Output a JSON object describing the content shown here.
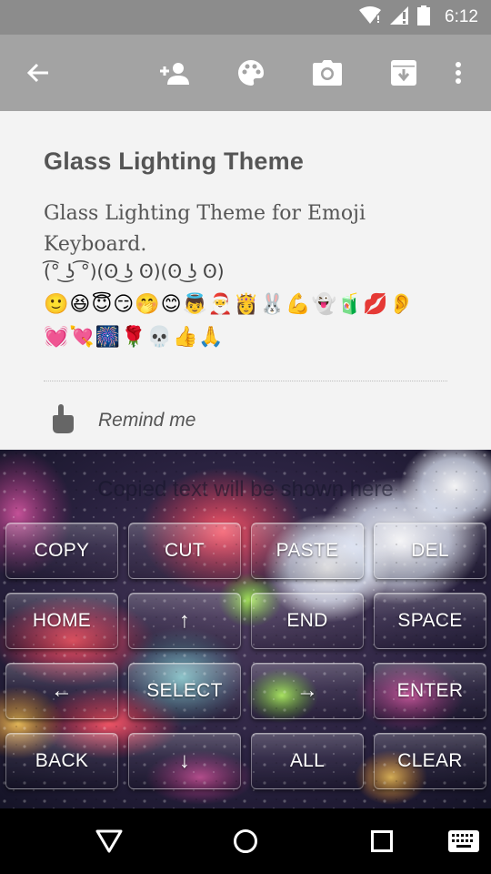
{
  "status_bar": {
    "time": "6:12"
  },
  "toolbar": {
    "icons": [
      "back-arrow-icon",
      "add-person-icon",
      "palette-icon",
      "camera-icon",
      "archive-icon",
      "more-vert-icon"
    ]
  },
  "note": {
    "title": "Glass Lighting Theme",
    "body": "Glass Lighting  Theme for Emoji\nKeyboard.",
    "kaomoji": "(͡° ͜ʖ ͡°)(ʘ ͜ʖ ʘ)(ʘ ͜ʖ ʘ)",
    "emoji_row_1": "🙂😆😇😏🤭😊👼🎅👸🐰💪👻🧃💋👂",
    "emoji_row_2": "💓💘🎆🌹💀👍🙏",
    "reminder_label": "Remind me"
  },
  "keyboard": {
    "clipboard_hint": "Copied text will be shown here",
    "keys": [
      {
        "label": "COPY"
      },
      {
        "label": "CUT"
      },
      {
        "label": "PASTE"
      },
      {
        "label": "DEL"
      },
      {
        "label": "HOME"
      },
      {
        "label": "↑"
      },
      {
        "label": "END"
      },
      {
        "label": "SPACE"
      },
      {
        "label": "←"
      },
      {
        "label": "SELECT"
      },
      {
        "label": "→"
      },
      {
        "label": "ENTER"
      },
      {
        "label": "BACK"
      },
      {
        "label": "↓"
      },
      {
        "label": "ALL"
      },
      {
        "label": "CLEAR"
      }
    ]
  },
  "navbar": {
    "icons": [
      "back-triangle-icon",
      "home-circle-icon",
      "recents-square-icon",
      "keyboard-icon"
    ]
  }
}
